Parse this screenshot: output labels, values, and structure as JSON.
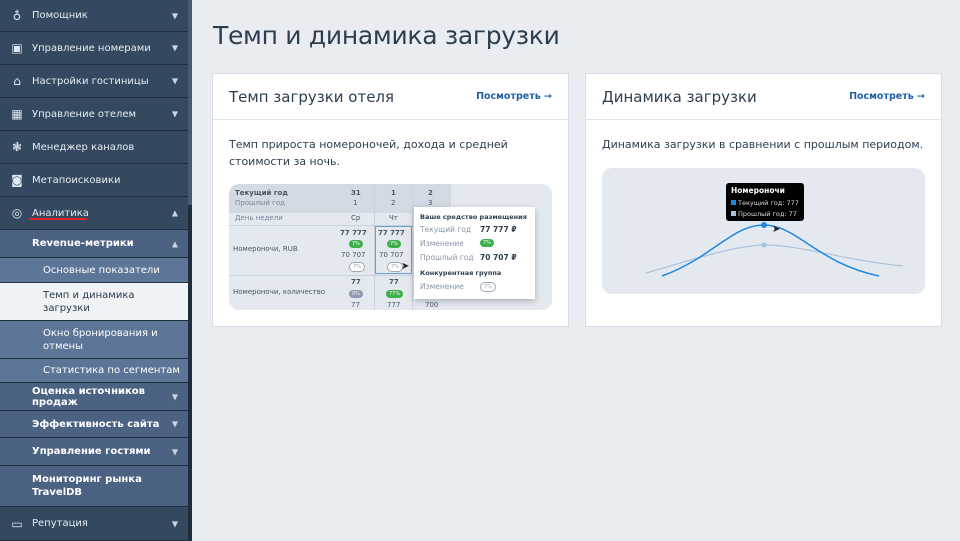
{
  "sidebar": {
    "items": [
      {
        "label": "Помощник",
        "icon": "lightbulb-icon"
      },
      {
        "label": "Управление номерами",
        "icon": "calendar-icon"
      },
      {
        "label": "Настройки гостиницы",
        "icon": "home-icon"
      },
      {
        "label": "Управление отелем",
        "icon": "grid-icon"
      },
      {
        "label": "Менеджер каналов",
        "icon": "channels-icon"
      },
      {
        "label": "Метапоисковики",
        "icon": "search-shield-icon"
      },
      {
        "label": "Аналитика",
        "icon": "analytics-icon"
      }
    ],
    "revenue": "Revenue-метрики",
    "revenue_sub": [
      "Основные показатели",
      "Темп и динамика загрузки",
      "Окно бронирования и отмены",
      "Статистика по сегментам"
    ],
    "analytics_sub": [
      "Оценка источников продаж",
      "Эффективность сайта",
      "Управление гостями",
      "Мониторинг рынка TravelDB"
    ],
    "reputation": "Репутация"
  },
  "page": {
    "title": "Темп и динамика загрузки"
  },
  "card1": {
    "title": "Темп загрузки отеля",
    "link": "Посмотреть →",
    "desc": "Темп прироста номероночей, дохода и средней стоимости за ночь.",
    "table": {
      "cur_year": "Текущий год",
      "prev_year": "Прошлый год",
      "weekday": "День недели",
      "cols": [
        {
          "cur": "31",
          "prev": "1",
          "day": "Ср"
        },
        {
          "cur": "1",
          "prev": "2",
          "day": "Чт"
        },
        {
          "cur": "2",
          "prev": "3",
          "day": ""
        }
      ],
      "row1": "Номероночи, RUB",
      "row2": "Номероночи, количество",
      "r1": [
        {
          "a": "77 777",
          "p": "7%",
          "b": "70 707",
          "q": "7%"
        },
        {
          "a": "77 777",
          "p": "7%",
          "b": "70 707",
          "q": "7%"
        }
      ],
      "r2": [
        {
          "a": "77",
          "p": "0%",
          "b": "77"
        },
        {
          "a": "77",
          "p": "77%",
          "b": "777"
        },
        {
          "b": "700"
        }
      ]
    },
    "tooltip": {
      "h1": "Ваше средство размещения",
      "cur": "Текущий год",
      "cur_v": "77 777 ₽",
      "chg": "Изменение",
      "chg_v": "7%",
      "prev": "Прошлый год",
      "prev_v": "70 707 ₽",
      "h2": "Конкурентная группа",
      "chg2": "Изменение",
      "chg2_v": "7%"
    }
  },
  "card2": {
    "title": "Динамика загрузки",
    "link": "Посмотреть →",
    "desc": "Динамика загрузки в сравнении с прошлым периодом.",
    "tooltip": {
      "title": "Номероночи",
      "cur": "Текущий год: 777",
      "prev": "Прошлый год: 77"
    },
    "colors": {
      "current": "#1e88e5",
      "previous": "#a9c3dc"
    }
  }
}
